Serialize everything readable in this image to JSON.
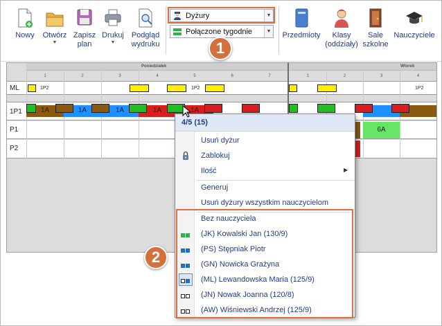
{
  "toolbar": {
    "buttons": [
      {
        "label": "Nowy",
        "icon": "new-document-icon"
      },
      {
        "label": "Otwórz",
        "icon": "open-folder-icon",
        "has_dropdown": true
      },
      {
        "label": "Zapisz plan",
        "icon": "save-icon",
        "has_dropdown": true
      },
      {
        "label": "Drukuj",
        "icon": "print-icon",
        "has_dropdown": true
      },
      {
        "label": "Podgląd wydruku",
        "icon": "print-preview-icon"
      },
      {
        "label": "Przedmioty",
        "icon": "subjects-book-icon"
      },
      {
        "label": "Klasy (oddziały)",
        "icon": "classes-student-icon"
      },
      {
        "label": "Sale szkolne",
        "icon": "classroom-door-icon"
      },
      {
        "label": "Nauczyciele",
        "icon": "teachers-cap-icon"
      }
    ],
    "labels": {
      "nowy": "Nowy",
      "otworz": "Otwórz",
      "zapisz_1": "Zapisz",
      "zapisz_2": "plan",
      "drukuj": "Drukuj",
      "podglad_1": "Podgląd",
      "podglad_2": "wydruku",
      "przedmioty": "Przedmioty",
      "klasy_1": "Klasy",
      "klasy_2": "(oddziały)",
      "sale_1": "Sale",
      "sale_2": "szkolne",
      "nauczyciele": "Nauczyciele"
    },
    "combo_view": {
      "value": "Dyżury",
      "icon": "duty-officer-icon"
    },
    "combo_mode": {
      "value": "Połączone tygodnie",
      "icon": "green-blocks-icon"
    }
  },
  "callouts": {
    "one": "1",
    "two": "2"
  },
  "grid": {
    "days": [
      "Poniedziałek",
      "Wtorek"
    ],
    "monday_periods": [
      "1",
      "2",
      "3",
      "4",
      "5",
      "6",
      "7"
    ],
    "tuesday_periods": [
      "1",
      "2",
      "3",
      "4"
    ],
    "rows": [
      "ML",
      "1P1",
      "P1",
      "P2"
    ],
    "duty_labels": {
      "ml_1": "1P2",
      "ml_2": "1P2",
      "ml_3": "1P2"
    },
    "lessons": {
      "a1": "1A",
      "a2": "1A",
      "a3": "1A",
      "a4": "1A",
      "a5": "1A",
      "p1_6a": "6A"
    }
  },
  "context_menu": {
    "header": "4/5 (15)",
    "items": {
      "usun_dyzur": "Usuń dyżur",
      "zablokuj": "Zablokuj",
      "ilosc": "Ilość",
      "generuj": "Generuj",
      "usun_wszystkie": "Usuń dyżury wszystkim nauczycielom",
      "bez_nauczyciela": "Bez nauczyciela"
    },
    "teachers": [
      {
        "label": "(JK) Kowalski Jan (130/9)",
        "icon": "green-blocks-icon"
      },
      {
        "label": "(PS) Stępniak Piotr",
        "icon": "blue-blocks-icon"
      },
      {
        "label": "(GN) Nowicka Grażyna",
        "icon": "blue-blocks-icon"
      },
      {
        "label": "(ML) Lewandowska Maria (125/9)",
        "icon": "outline-blue-block-icon"
      },
      {
        "label": "(JN) Nowak Joanna (120/8)",
        "icon": "outline-blocks-icon"
      },
      {
        "label": "(AW) Wiśniewski Andrzej (125/9)",
        "icon": "outline-blocks-icon"
      }
    ]
  },
  "colors": {
    "accent_orange": "#e36c3a",
    "link_blue": "#1f3c88",
    "lesson_blue": "#1e90ff",
    "lesson_brown": "#8b5a12",
    "lesson_green": "#20c020",
    "lesson_red": "#d81e1e",
    "duty_yellow": "#ffee00"
  }
}
